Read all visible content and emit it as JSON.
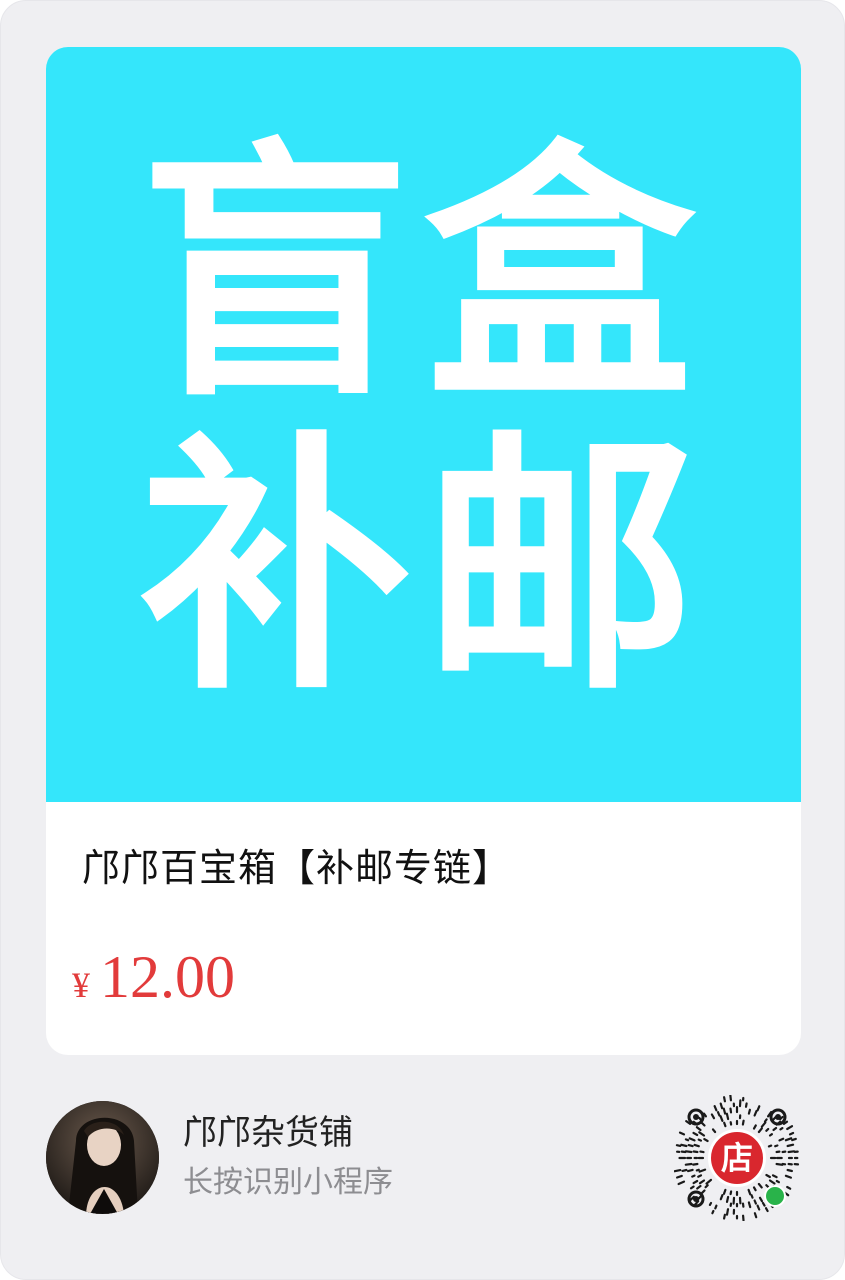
{
  "hero": {
    "line1": "盲盒",
    "line2": "补邮",
    "background_color": "#34e6fb",
    "text_color": "#ffffff"
  },
  "product": {
    "title": "邝邝百宝箱【补邮专链】",
    "currency": "¥",
    "price": "12.00",
    "price_color": "#e23b3b"
  },
  "shop": {
    "name": "邝邝杂货铺",
    "hint": "长按识别小程序",
    "avatar_icon": "user-avatar-photo"
  },
  "mini_program_code": {
    "badge": "店",
    "badge_color": "#d9272e",
    "icon": "wechat-mini-program-code-icon",
    "corner_icon": "mini-program-link-icon"
  }
}
